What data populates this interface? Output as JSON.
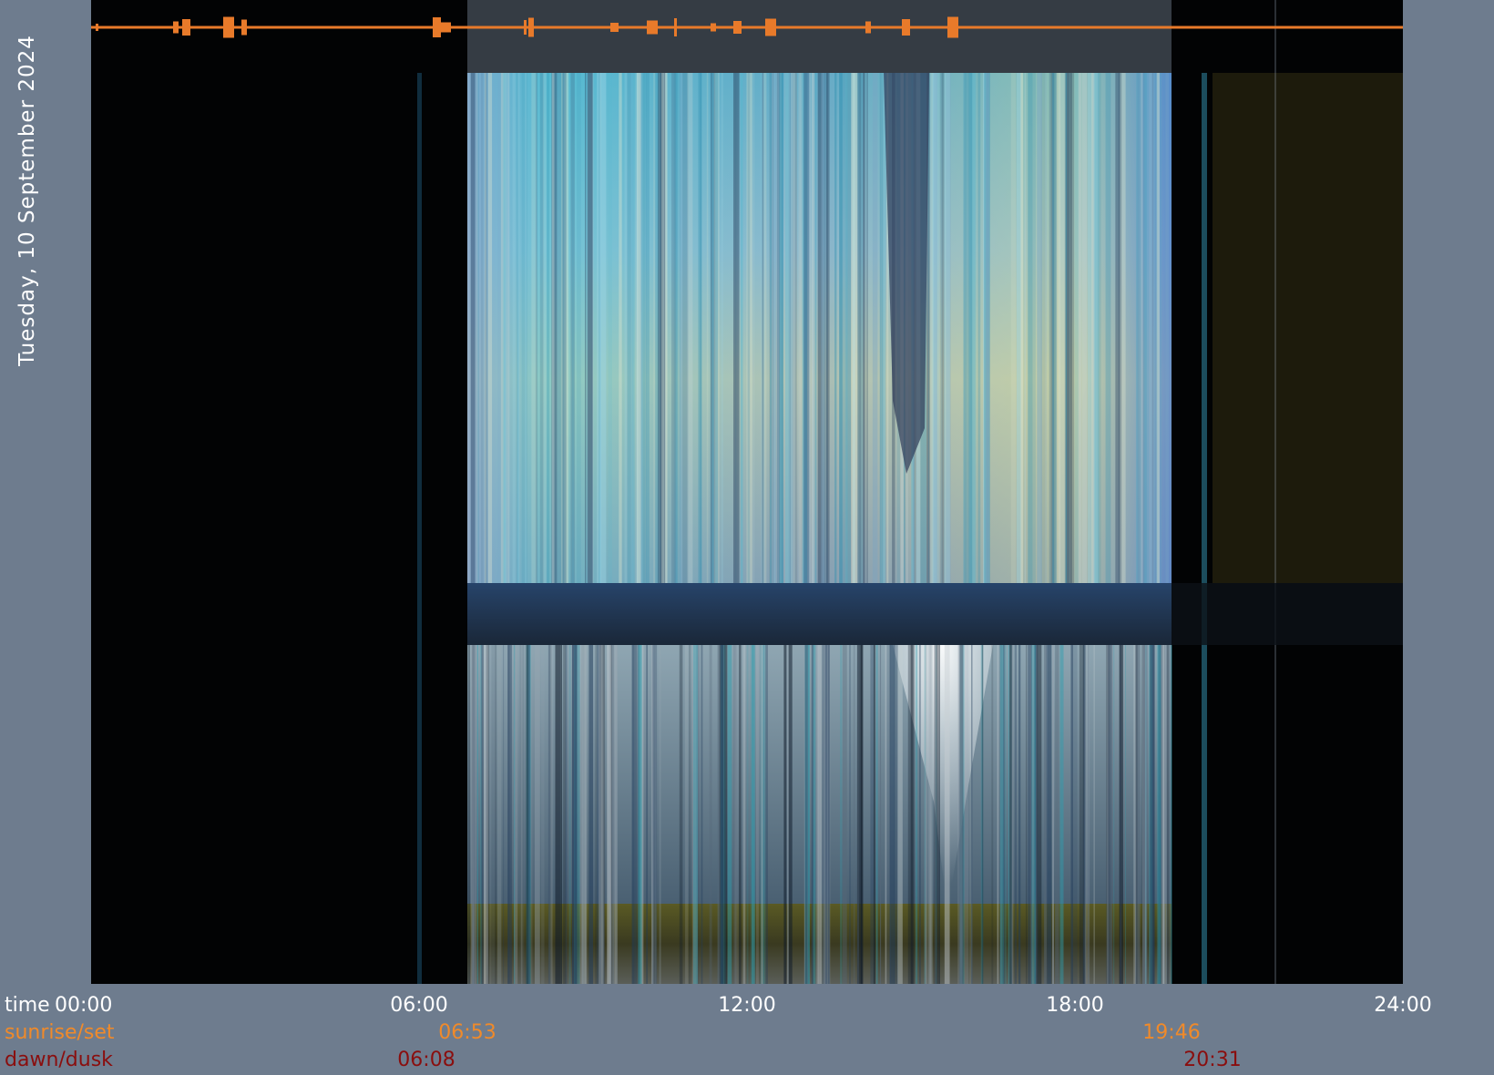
{
  "date_title": "Tuesday, 10 September 2024",
  "colors": {
    "background": "#6e7c8e",
    "night": "#020304",
    "sunrise_set": "#f08a2a",
    "dawn_dusk": "#8a0e0e",
    "activity_trace": "#e87a2a",
    "time_text": "#ffffff"
  },
  "chart_data": {
    "type": "heatmap",
    "description_kind": "keogram",
    "x_axis": {
      "range": [
        "00:00",
        "24:00"
      ],
      "tick_labels": [
        "00:00",
        "06:00",
        "12:00",
        "18:00",
        "24:00"
      ],
      "row_label": "time"
    },
    "rows": [
      {
        "key": "sunrise_set",
        "label": "sunrise/set",
        "values": [
          "06:53",
          "19:46"
        ]
      },
      {
        "key": "dawn_dusk",
        "label": "dawn/dusk",
        "values": [
          "06:08",
          "20:31"
        ]
      }
    ],
    "events": {
      "dawn": "06:08",
      "sunrise": "06:53",
      "sunset": "19:46",
      "dusk": "20:31"
    }
  }
}
